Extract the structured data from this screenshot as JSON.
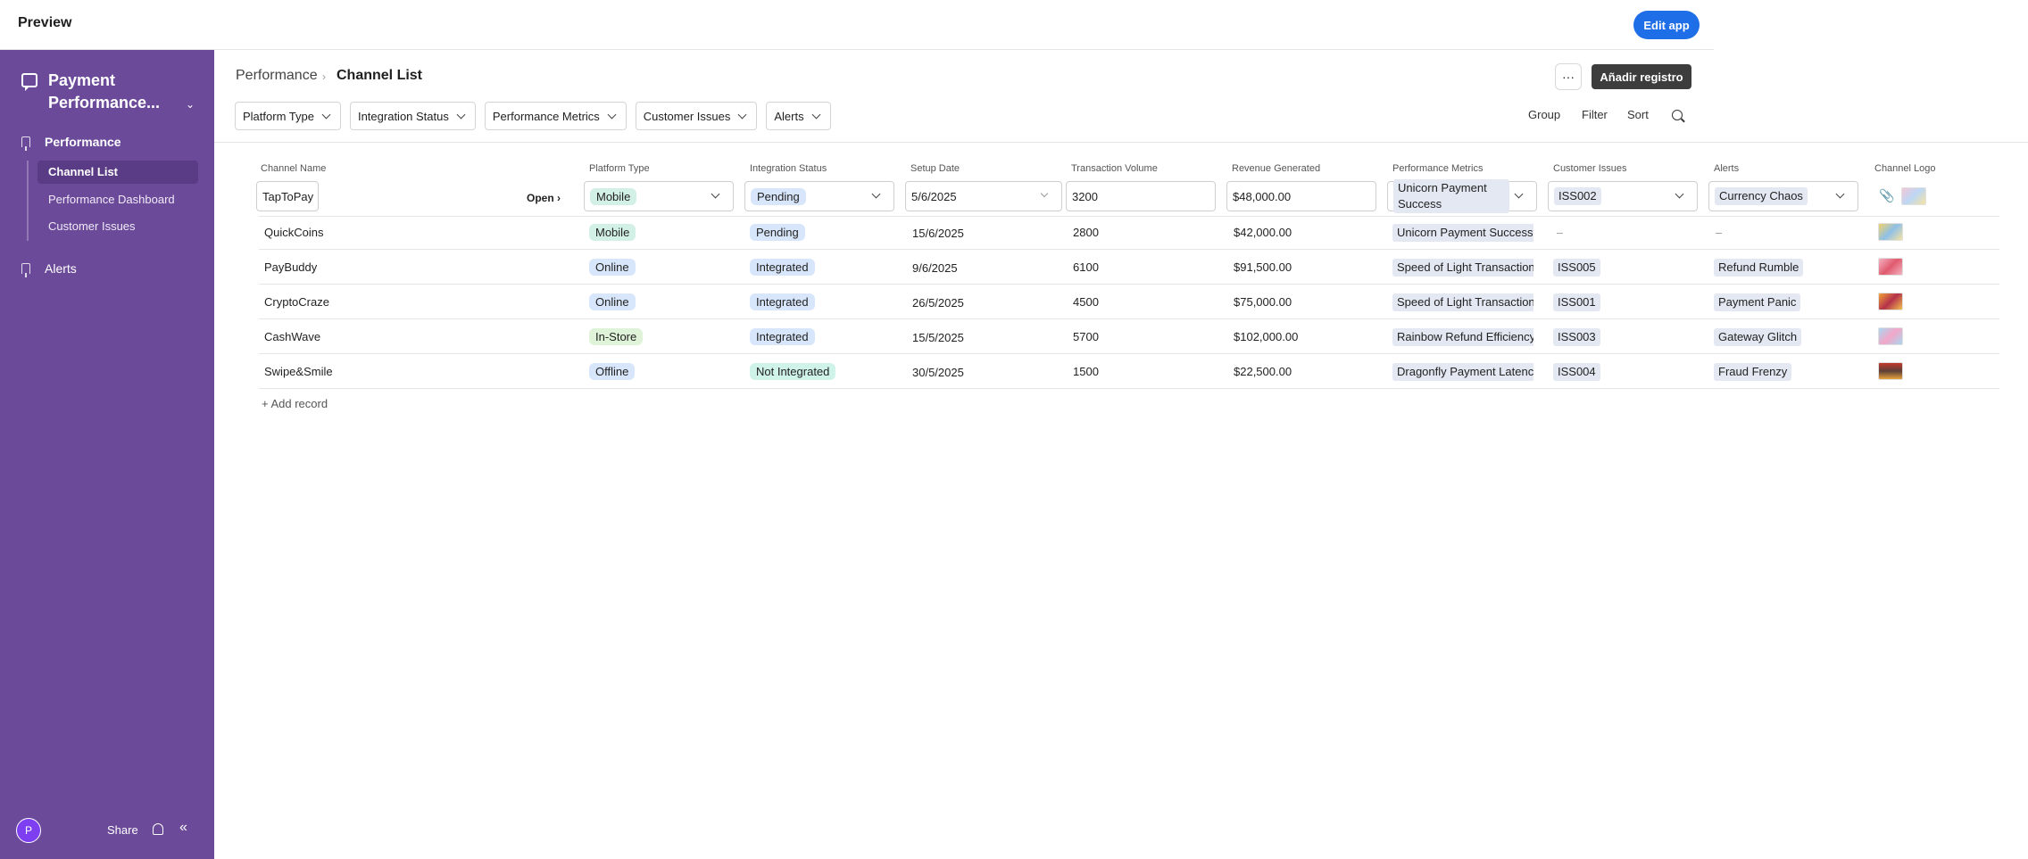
{
  "topbar": {
    "title": "Preview",
    "edit_button": "Edit app"
  },
  "sidebar": {
    "app_name": "Payment Performance...",
    "groups": [
      {
        "label": "Performance",
        "items": [
          "Channel List",
          "Performance Dashboard",
          "Customer Issues"
        ]
      },
      {
        "label": "Alerts"
      }
    ],
    "footer": {
      "avatar_letter": "P",
      "share": "Share"
    }
  },
  "header": {
    "breadcrumb_parent": "Performance",
    "breadcrumb_sep": "›",
    "breadcrumb_current": "Channel List",
    "more": "···",
    "add_button": "Añadir registro"
  },
  "filters": [
    "Platform Type",
    "Integration Status",
    "Performance Metrics",
    "Customer Issues",
    "Alerts"
  ],
  "tools": {
    "group": "Group",
    "filter": "Filter",
    "sort": "Sort"
  },
  "table": {
    "columns": [
      "Channel Name",
      "Platform Type",
      "Integration Status",
      "Setup Date",
      "Transaction Volume",
      "Revenue Generated",
      "Performance Metrics",
      "Customer Issues",
      "Alerts",
      "Channel Logo"
    ],
    "edit_row": {
      "name": "TapToPay",
      "open": "Open ›",
      "platform": "Mobile",
      "status": "Pending",
      "date": "5/6/2025",
      "volume": "3200",
      "revenue": "$48,000.00",
      "metric": "Unicorn Payment Success",
      "issue": "ISS002",
      "alert": "Currency Chaos"
    },
    "rows": [
      {
        "name": "QuickCoins",
        "platform": "Mobile",
        "status": "Pending",
        "date": "15/6/2025",
        "volume": "2800",
        "revenue": "$42,000.00",
        "metric": "Unicorn Payment Success Rate",
        "issue": "–",
        "alert": "–"
      },
      {
        "name": "PayBuddy",
        "platform": "Online",
        "status": "Integrated",
        "date": "9/6/2025",
        "volume": "6100",
        "revenue": "$91,500.00",
        "metric": "Speed of Light Transaction",
        "issue": "ISS005",
        "alert": "Refund Rumble"
      },
      {
        "name": "CryptoCraze",
        "platform": "Online",
        "status": "Integrated",
        "date": "26/5/2025",
        "volume": "4500",
        "revenue": "$75,000.00",
        "metric": "Speed of Light Transaction",
        "issue": "ISS001",
        "alert": "Payment Panic"
      },
      {
        "name": "CashWave",
        "platform": "In-Store",
        "status": "Integrated",
        "date": "15/5/2025",
        "volume": "5700",
        "revenue": "$102,000.00",
        "metric": "Rainbow Refund Efficiency",
        "issue": "ISS003",
        "alert": "Gateway Glitch"
      },
      {
        "name": "Swipe&Smile",
        "platform": "Offline",
        "status": "Not Integrated",
        "date": "30/5/2025",
        "volume": "1500",
        "revenue": "$22,500.00",
        "metric": "Dragonfly Payment Latency",
        "issue": "ISS004",
        "alert": "Fraud Frenzy"
      }
    ],
    "add_record": "+ Add record"
  },
  "colors": {
    "sidebar": "#6c4a9a",
    "primary": "#1e6ee8"
  }
}
